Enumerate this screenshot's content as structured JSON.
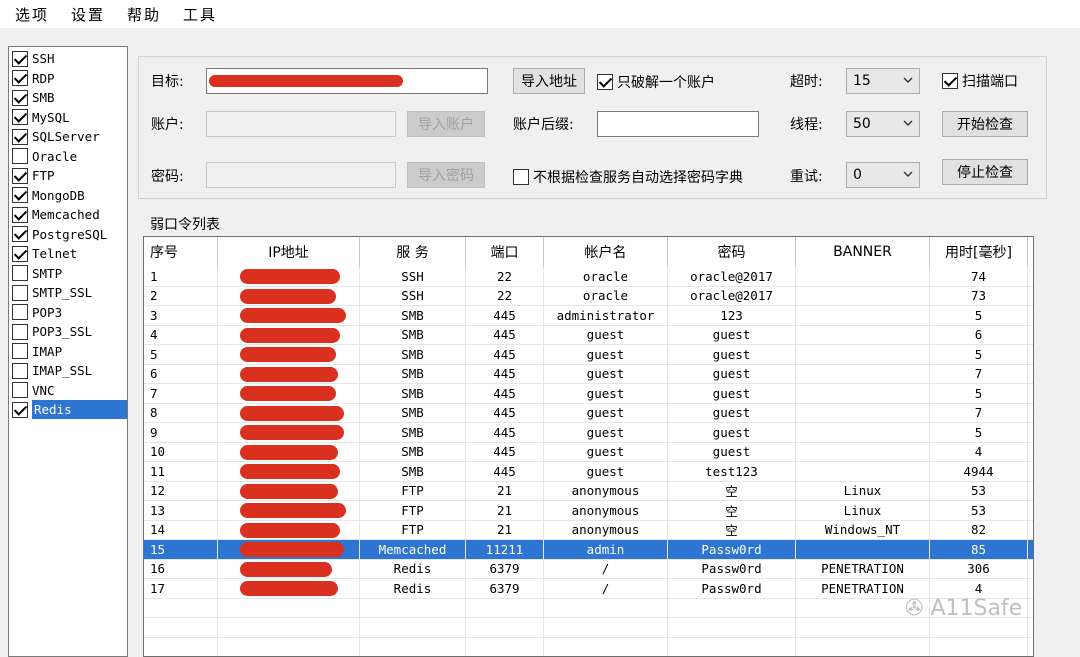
{
  "menu": [
    "选项",
    "设置",
    "帮助",
    "工具"
  ],
  "services": [
    {
      "name": "SSH",
      "checked": true
    },
    {
      "name": "RDP",
      "checked": true
    },
    {
      "name": "SMB",
      "checked": true
    },
    {
      "name": "MySQL",
      "checked": true
    },
    {
      "name": "SQLServer",
      "checked": true
    },
    {
      "name": "Oracle",
      "checked": false
    },
    {
      "name": "FTP",
      "checked": true
    },
    {
      "name": "MongoDB",
      "checked": true
    },
    {
      "name": "Memcached",
      "checked": true
    },
    {
      "name": "PostgreSQL",
      "checked": true
    },
    {
      "name": "Telnet",
      "checked": true
    },
    {
      "name": "SMTP",
      "checked": false
    },
    {
      "name": "SMTP_SSL",
      "checked": false
    },
    {
      "name": "POP3",
      "checked": false
    },
    {
      "name": "POP3_SSL",
      "checked": false
    },
    {
      "name": "IMAP",
      "checked": false
    },
    {
      "name": "IMAP_SSL",
      "checked": false
    },
    {
      "name": "VNC",
      "checked": false
    },
    {
      "name": "Redis",
      "checked": true,
      "selected": true
    }
  ],
  "form": {
    "target_label": "目标:",
    "target_value": "",
    "account_label": "账户:",
    "password_label": "密码:",
    "import_address": "导入地址",
    "import_account": "导入账户",
    "import_password": "导入密码",
    "only_one_account": "只破解一个账户",
    "account_suffix_label": "账户后缀:",
    "account_suffix_value": "",
    "no_auto_dict": "不根据检查服务自动选择密码字典",
    "timeout_label": "超时:",
    "timeout_value": "15",
    "threads_label": "线程:",
    "threads_value": "50",
    "retry_label": "重试:",
    "retry_value": "0",
    "scan_port": "扫描端口",
    "start_check": "开始检查",
    "stop_check": "停止检查"
  },
  "results": {
    "title": "弱口令列表",
    "columns": [
      "序号",
      "IP地址",
      "服 务",
      "端口",
      "帐户名",
      "密码",
      "BANNER",
      "用时[毫秒]"
    ],
    "rows": [
      [
        "1",
        "",
        "SSH",
        "22",
        "oracle",
        "oracle@2017",
        "",
        "74"
      ],
      [
        "2",
        "",
        "SSH",
        "22",
        "oracle",
        "oracle@2017",
        "",
        "73"
      ],
      [
        "3",
        "",
        "SMB",
        "445",
        "administrator",
        "123",
        "",
        "5"
      ],
      [
        "4",
        "",
        "SMB",
        "445",
        "guest",
        "guest",
        "",
        "6"
      ],
      [
        "5",
        "",
        "SMB",
        "445",
        "guest",
        "guest",
        "",
        "5"
      ],
      [
        "6",
        "",
        "SMB",
        "445",
        "guest",
        "guest",
        "",
        "7"
      ],
      [
        "7",
        "",
        "SMB",
        "445",
        "guest",
        "guest",
        "",
        "5"
      ],
      [
        "8",
        "",
        "SMB",
        "445",
        "guest",
        "guest",
        "",
        "7"
      ],
      [
        "9",
        "",
        "SMB",
        "445",
        "guest",
        "guest",
        "",
        "5"
      ],
      [
        "10",
        "",
        "SMB",
        "445",
        "guest",
        "guest",
        "",
        "4"
      ],
      [
        "11",
        "",
        "SMB",
        "445",
        "guest",
        "test123",
        "",
        "4944"
      ],
      [
        "12",
        "",
        "FTP",
        "21",
        "anonymous",
        "空",
        "Linux",
        "53"
      ],
      [
        "13",
        "",
        "FTP",
        "21",
        "anonymous",
        "空",
        "Linux",
        "53"
      ],
      [
        "14",
        "",
        "FTP",
        "21",
        "anonymous",
        "空",
        "Windows_NT",
        "82"
      ],
      [
        "15",
        "",
        "Memcached",
        "11211",
        "admin",
        "Passw0rd",
        "",
        "85"
      ],
      [
        "16",
        "",
        "Redis",
        "6379",
        "/",
        "Passw0rd",
        "PENETRATION",
        "306"
      ],
      [
        "17",
        "",
        "Redis",
        "6379",
        "/",
        "Passw0rd",
        "PENETRATION",
        "4"
      ]
    ],
    "selected_row": 14
  },
  "watermark": "A11Safe"
}
